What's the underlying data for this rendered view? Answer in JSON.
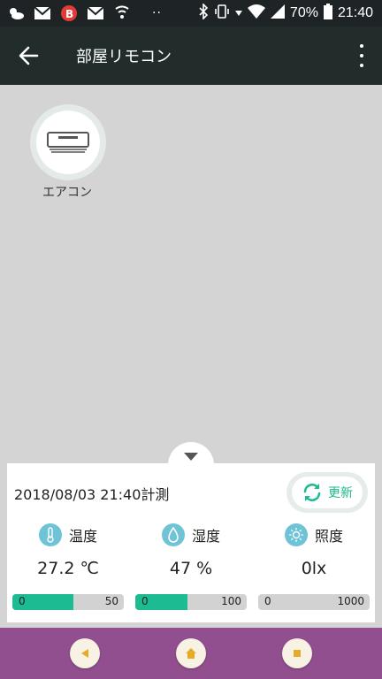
{
  "status_bar": {
    "battery": "70%",
    "time": "21:40",
    "icons": [
      "weather-icon",
      "gmail-icon",
      "b-app-icon",
      "gmail-icon",
      "wifi-call-icon"
    ]
  },
  "app_bar": {
    "title": "部屋リモコン"
  },
  "device": {
    "label": "エアコン",
    "icon": "air-conditioner-icon"
  },
  "panel": {
    "measured_at": "2018/08/03 21:40計測",
    "refresh_label": "更新",
    "sensors": [
      {
        "name": "温度",
        "value": "27.2 ℃",
        "min": "0",
        "max": "50",
        "fill_fraction": 0.544
      },
      {
        "name": "湿度",
        "value": "47 %",
        "min": "0",
        "max": "100",
        "fill_fraction": 0.47
      },
      {
        "name": "照度",
        "value": "0lx",
        "min": "0",
        "max": "1000",
        "fill_fraction": 0.0
      }
    ]
  },
  "colors": {
    "status_bar": "#1e2426",
    "app_bar": "#222d2b",
    "background": "#d4d4d4",
    "accent": "#1dbb91",
    "sensor_icon": "#6ec3d7",
    "nav_bar": "#924f8f",
    "nav_button": "#f7f2e4"
  }
}
